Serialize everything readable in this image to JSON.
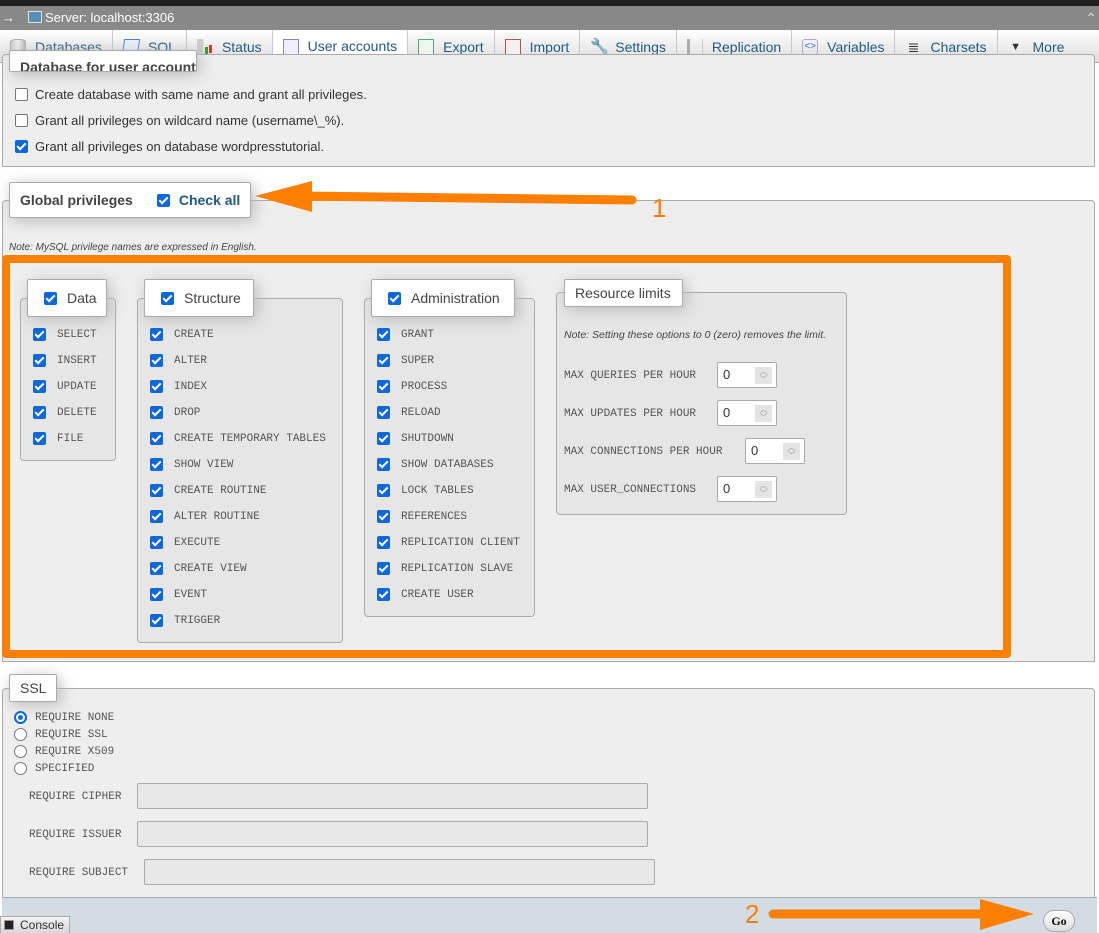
{
  "server_bar": {
    "back_arrow": "→",
    "server_label": "Server: localhost:3306",
    "collapse_glyph": "⌃"
  },
  "nav_tabs": [
    {
      "label": "Databases",
      "icon": "database-icon",
      "active": false
    },
    {
      "label": "SQL",
      "icon": "sql-icon",
      "active": false
    },
    {
      "label": "Status",
      "icon": "status-icon",
      "active": false
    },
    {
      "label": "User accounts",
      "icon": "user-accounts-icon",
      "active": true
    },
    {
      "label": "Export",
      "icon": "export-icon",
      "active": false
    },
    {
      "label": "Import",
      "icon": "import-icon",
      "active": false
    },
    {
      "label": "Settings",
      "icon": "wrench-icon",
      "active": false
    },
    {
      "label": "Replication",
      "icon": "replication-icon",
      "active": false
    },
    {
      "label": "Variables",
      "icon": "variables-icon",
      "active": false
    },
    {
      "label": "Charsets",
      "icon": "charsets-icon",
      "active": false
    },
    {
      "label": "More",
      "icon": "triangle-down-icon",
      "active": false
    }
  ],
  "database_section": {
    "legend": "Database for user account",
    "options": [
      {
        "label": "Create database with same name and grant all privileges.",
        "checked": false
      },
      {
        "label": "Grant all privileges on wildcard name (username\\_%).",
        "checked": false
      },
      {
        "label": "Grant all privileges on database wordpresstutorial.",
        "checked": true
      }
    ]
  },
  "global_privileges": {
    "legend": "Global privileges",
    "check_all_label": "Check all",
    "check_all_checked": true,
    "note": "Note: MySQL privilege names are expressed in English.",
    "groups": [
      {
        "name": "Data",
        "checked": true,
        "items": [
          "SELECT",
          "INSERT",
          "UPDATE",
          "DELETE",
          "FILE"
        ]
      },
      {
        "name": "Structure",
        "checked": true,
        "items": [
          "CREATE",
          "ALTER",
          "INDEX",
          "DROP",
          "CREATE TEMPORARY TABLES",
          "SHOW VIEW",
          "CREATE ROUTINE",
          "ALTER ROUTINE",
          "EXECUTE",
          "CREATE VIEW",
          "EVENT",
          "TRIGGER"
        ]
      },
      {
        "name": "Administration",
        "checked": true,
        "items": [
          "GRANT",
          "SUPER",
          "PROCESS",
          "RELOAD",
          "SHUTDOWN",
          "SHOW DATABASES",
          "LOCK TABLES",
          "REFERENCES",
          "REPLICATION CLIENT",
          "REPLICATION SLAVE",
          "CREATE USER"
        ]
      }
    ],
    "resource_limits": {
      "legend": "Resource limits",
      "note": "Note: Setting these options to 0 (zero) removes the limit.",
      "fields": [
        {
          "label": "MAX QUERIES PER HOUR",
          "value": "0"
        },
        {
          "label": "MAX UPDATES PER HOUR",
          "value": "0"
        },
        {
          "label": "MAX CONNECTIONS PER HOUR",
          "value": "0"
        },
        {
          "label": "MAX USER_CONNECTIONS",
          "value": "0"
        }
      ]
    }
  },
  "ssl": {
    "legend": "SSL",
    "options": [
      {
        "label": "REQUIRE NONE",
        "selected": true
      },
      {
        "label": "REQUIRE SSL",
        "selected": false
      },
      {
        "label": "REQUIRE X509",
        "selected": false
      },
      {
        "label": "SPECIFIED",
        "selected": false
      }
    ],
    "fields": [
      {
        "label": "REQUIRE CIPHER",
        "value": ""
      },
      {
        "label": "REQUIRE ISSUER",
        "value": ""
      },
      {
        "label": "REQUIRE SUBJECT",
        "value": ""
      }
    ]
  },
  "footer": {
    "go_label": "Go",
    "console_label": "Console"
  },
  "annotations": {
    "color": "#ff7f00",
    "step1": "1",
    "step2": "2"
  },
  "colors": {
    "accent_blue": "#0b68d6",
    "tab_text": "#235a81",
    "panel_bg": "#eeeeee",
    "footer_bg": "#d3dce3"
  }
}
